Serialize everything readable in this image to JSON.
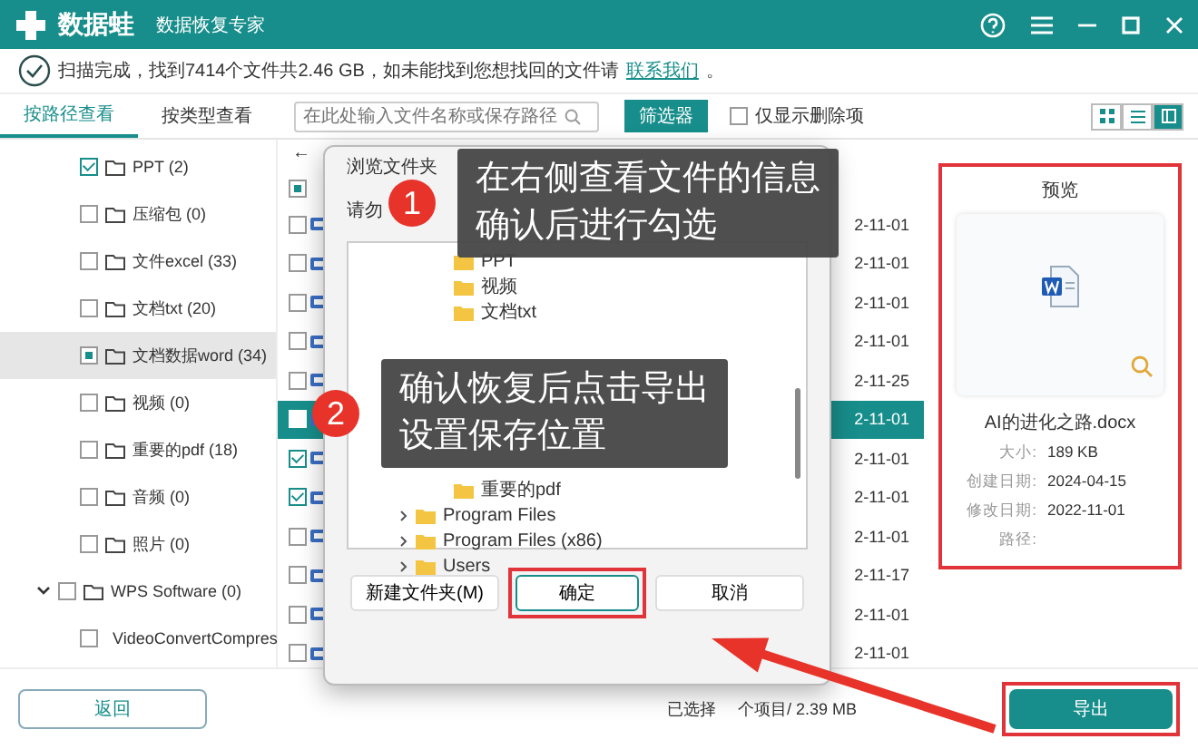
{
  "header": {
    "logo": "数据蛙",
    "subtitle": "数据恢复专家"
  },
  "status": {
    "text": "扫描完成，找到7414个文件共2.46 GB，如未能找到您想找回的文件请",
    "link": "联系我们",
    "end": "。"
  },
  "view_tabs": [
    {
      "label": "按路径查看",
      "selected": true
    },
    {
      "label": "按类型查看",
      "selected": false
    }
  ],
  "search": {
    "placeholder": "在此处输入文件名称或保存路径"
  },
  "filter_button": "筛选器",
  "deleted_only": {
    "label": "仅显示删除项",
    "checked": false
  },
  "view_modes": [
    {
      "kind": "grid",
      "selected": false
    },
    {
      "kind": "list",
      "selected": false
    },
    {
      "kind": "detail",
      "selected": true
    }
  ],
  "tree": [
    {
      "label": "PPT (2)",
      "checked": true,
      "selected": false
    },
    {
      "label": "压缩包 (0)",
      "checked": false,
      "selected": false
    },
    {
      "label": "文件excel (33)",
      "checked": false,
      "selected": false
    },
    {
      "label": "文档txt (20)",
      "checked": false,
      "selected": false
    },
    {
      "label": "文档数据word (34)",
      "checked": true,
      "partial": true,
      "selected": true
    },
    {
      "label": "视频 (0)",
      "checked": false,
      "selected": false
    },
    {
      "label": "重要的pdf (18)",
      "checked": false,
      "selected": false
    },
    {
      "label": "音频 (0)",
      "checked": false,
      "selected": false
    },
    {
      "label": "照片 (0)",
      "checked": false,
      "selected": false
    },
    {
      "label": "WPS Software (0)",
      "checked": false,
      "selected": false,
      "expanded": true,
      "children": [
        {
          "label": "VideoConvertCompres",
          "checked": false,
          "selected": false
        }
      ]
    }
  ],
  "file_list": {
    "back": "←",
    "all_partial": true,
    "rows": [
      {
        "checked": false,
        "selected": false,
        "date": "2-11-01"
      },
      {
        "checked": false,
        "selected": false,
        "date": "2-11-01"
      },
      {
        "checked": false,
        "selected": false,
        "date": "2-11-01"
      },
      {
        "checked": false,
        "selected": false,
        "date": "2-11-01"
      },
      {
        "checked": false,
        "selected": false,
        "date": "2-11-25"
      },
      {
        "checked": false,
        "selected": true,
        "date": "2-11-01"
      },
      {
        "checked": true,
        "selected": false,
        "date": "2-11-01"
      },
      {
        "checked": true,
        "selected": false,
        "date": "2-11-01"
      },
      {
        "checked": false,
        "selected": false,
        "date": "2-11-01"
      },
      {
        "checked": false,
        "selected": false,
        "date": "2-11-17"
      },
      {
        "checked": false,
        "selected": false,
        "date": "2-11-01"
      },
      {
        "checked": false,
        "selected": false,
        "date": "2-11-01"
      }
    ]
  },
  "preview": {
    "title": "预览",
    "file_name": "AI的进化之路.docx",
    "fields": [
      {
        "label": "大小:",
        "value": "189 KB"
      },
      {
        "label": "创建日期:",
        "value": "2024-04-15"
      },
      {
        "label": "修改日期:",
        "value": "2022-11-01"
      },
      {
        "label": "路径:"
      }
    ]
  },
  "bottom": {
    "back_button": "返回",
    "selected_prefix": "已选择",
    "selected_suffix": "个项目/ 2.39 MB",
    "export_button": "导出"
  },
  "dialog": {
    "title": "浏览文件夹",
    "hint": "请勿",
    "top_folders": [
      "PPT",
      "视频",
      "文档txt"
    ],
    "bottom_folders": [
      {
        "label": "重要的pdf",
        "expandable": false
      },
      {
        "label": "Program Files",
        "expandable": true
      },
      {
        "label": "Program Files (x86)",
        "expandable": true
      },
      {
        "label": "Users",
        "expandable": true
      }
    ],
    "buttons": [
      {
        "label": "新建文件夹(M)",
        "highlighted": false
      },
      {
        "label": "确定",
        "highlighted": true
      },
      {
        "label": "取消",
        "highlighted": false
      }
    ]
  },
  "callouts": [
    {
      "number": "1",
      "lines": [
        "在右侧查看文件的信息",
        "确认后进行勾选"
      ]
    },
    {
      "number": "2",
      "lines": [
        "确认恢复后点击导出",
        "设置保存位置"
      ]
    }
  ]
}
